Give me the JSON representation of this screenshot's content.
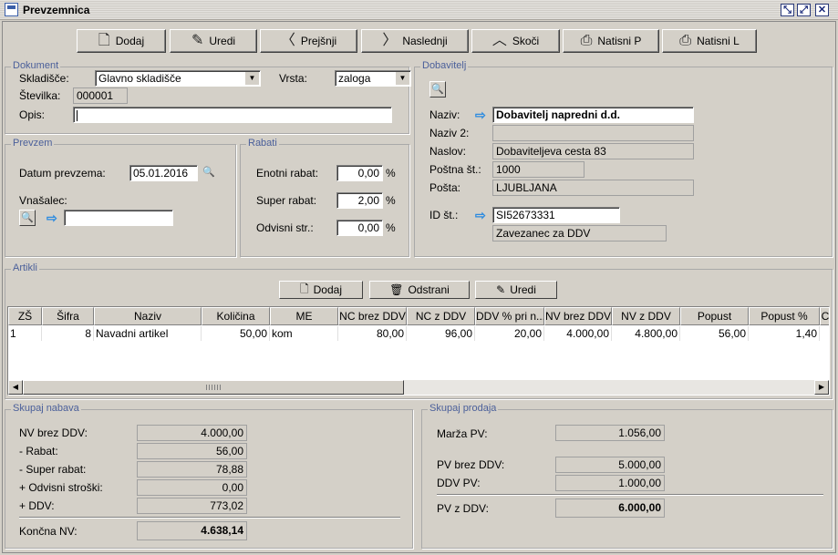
{
  "window": {
    "title": "Prevzemnica"
  },
  "toolbar": {
    "dodaj": "Dodaj",
    "uredi": "Uredi",
    "prejsnji": "Prejšnji",
    "naslednji": "Naslednji",
    "skoci": "Skoči",
    "natisni_p": "Natisni P",
    "natisni_l": "Natisni L"
  },
  "dokument": {
    "legend": "Dokument",
    "skladisce_label": "Skladišče:",
    "skladisce_value": "Glavno skladišče",
    "vrsta_label": "Vrsta:",
    "vrsta_value": "zaloga",
    "stevilka_label": "Številka:",
    "stevilka_value": "000001",
    "opis_label": "Opis:",
    "opis_value": ""
  },
  "prevzem": {
    "legend": "Prevzem",
    "datum_label": "Datum prevzema:",
    "datum_value": "05.01.2016",
    "vnasalec_label": "Vnašalec:",
    "vnasalec_value": ""
  },
  "rabati": {
    "legend": "Rabati",
    "enotni_label": "Enotni rabat:",
    "enotni_value": "0,00",
    "super_label": "Super rabat:",
    "super_value": "2,00",
    "odvisni_label": "Odvisni str.:",
    "odvisni_value": "0,00",
    "pct": "%"
  },
  "dobavitelj": {
    "legend": "Dobavitelj",
    "naziv_label": "Naziv:",
    "naziv_value": "Dobavitelj napredni d.d.",
    "naziv2_label": "Naziv 2:",
    "naziv2_value": "",
    "naslov_label": "Naslov:",
    "naslov_value": "Dobaviteljeva cesta 83",
    "postna_label": "Poštna št.:",
    "postna_value": "1000",
    "posta_label": "Pošta:",
    "posta_value": "LJUBLJANA",
    "id_label": "ID št.:",
    "id_value": "SI52673331",
    "zavezanec": "Zavezanec za DDV"
  },
  "artikli": {
    "legend": "Artikli",
    "dodaj": "Dodaj",
    "odstrani": "Odstrani",
    "uredi": "Uredi",
    "columns": [
      "ZŠ",
      "Šifra",
      "Naziv",
      "Količina",
      "ME",
      "NC brez DDV",
      "NC z DDV",
      "DDV % pri n...",
      "NV brez DDV",
      "NV z DDV",
      "Popust",
      "Popust %",
      "C"
    ],
    "rows": [
      [
        "1",
        "8",
        "Navadni artikel",
        "50,00",
        "kom",
        "80,00",
        "96,00",
        "20,00",
        "4.000,00",
        "4.800,00",
        "56,00",
        "1,40",
        ""
      ]
    ]
  },
  "skupaj_nabava": {
    "legend": "Skupaj nabava",
    "nv_brez_label": "NV brez DDV:",
    "nv_brez_value": "4.000,00",
    "rabat_label": "- Rabat:",
    "rabat_value": "56,00",
    "super_label": "- Super rabat:",
    "super_value": "78,88",
    "odvisni_label": "+ Odvisni stroški:",
    "odvisni_value": "0,00",
    "ddv_label": "+ DDV:",
    "ddv_value": "773,02",
    "koncna_label": "Končna NV:",
    "koncna_value": "4.638,14"
  },
  "skupaj_prodaja": {
    "legend": "Skupaj prodaja",
    "marza_label": "Marža PV:",
    "marza_value": "1.056,00",
    "pv_brez_label": "PV brez DDV:",
    "pv_brez_value": "5.000,00",
    "ddv_pv_label": "DDV PV:",
    "ddv_pv_value": "1.000,00",
    "pv_z_label": "PV z DDV:",
    "pv_z_value": "6.000,00"
  }
}
